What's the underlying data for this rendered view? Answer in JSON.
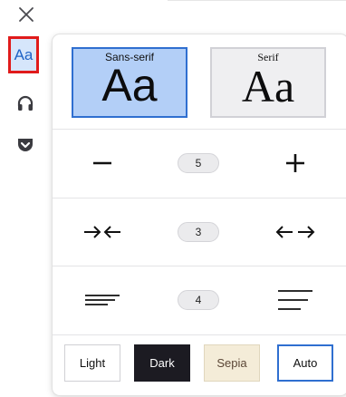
{
  "toolbar": {
    "close_icon": "close-icon",
    "reader_button_label": "Aa",
    "audio_icon": "headphones-icon",
    "pocket_icon": "pocket-icon"
  },
  "fonts": {
    "sans": {
      "label": "Sans-serif",
      "sample": "Aa",
      "selected": true
    },
    "serif": {
      "label": "Serif",
      "sample": "Aa",
      "selected": false
    }
  },
  "font_size": {
    "value": "5",
    "decrease_icon": "minus-icon",
    "increase_icon": "plus-icon"
  },
  "content_width": {
    "value": "3",
    "narrow_icon": "arrows-inward-icon",
    "wide_icon": "arrows-outward-icon"
  },
  "line_height": {
    "value": "4",
    "tight_icon": "lines-tight-icon",
    "loose_icon": "lines-loose-icon"
  },
  "themes": [
    {
      "label": "Light",
      "bg": "#ffffff",
      "fg": "#111111",
      "border": "#d0d0d4",
      "selected": false
    },
    {
      "label": "Dark",
      "bg": "#1c1b22",
      "fg": "#ffffff",
      "border": "#1c1b22",
      "selected": false
    },
    {
      "label": "Sepia",
      "bg": "#f4ecd8",
      "fg": "#5b4636",
      "border": "#e0d6bd",
      "selected": false
    },
    {
      "label": "Auto",
      "bg": "#ffffff",
      "fg": "#111111",
      "border": "#2f6fd0",
      "selected": true
    }
  ],
  "colors": {
    "accent": "#2f6fd0",
    "highlight_border": "#e01b1b"
  }
}
